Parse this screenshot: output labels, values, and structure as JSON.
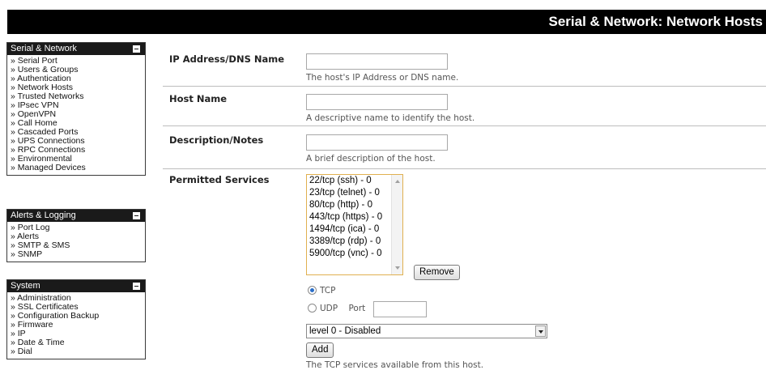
{
  "page": {
    "title": "Serial & Network: Network Hosts"
  },
  "sidebar": {
    "sections": [
      {
        "title": "Serial & Network",
        "items": [
          "» Serial Port",
          "» Users & Groups",
          "» Authentication",
          "» Network Hosts",
          "» Trusted Networks",
          "» IPsec VPN",
          "» OpenVPN",
          "» Call Home",
          "» Cascaded Ports",
          "» UPS Connections",
          "» RPC Connections",
          "» Environmental",
          "» Managed Devices"
        ]
      },
      {
        "title": "Alerts & Logging",
        "items": [
          "» Port Log",
          "» Alerts",
          "» SMTP & SMS",
          "» SNMP"
        ]
      },
      {
        "title": "System",
        "items": [
          "» Administration",
          "» SSL Certificates",
          "» Configuration Backup",
          "» Firmware",
          "» IP",
          "» Date & Time",
          "» Dial"
        ]
      }
    ]
  },
  "form": {
    "ip": {
      "label": "IP Address/DNS Name",
      "value": "",
      "hint": "The host's IP Address or DNS name."
    },
    "hostname": {
      "label": "Host Name",
      "value": "",
      "hint": "A descriptive name to identify the host."
    },
    "description": {
      "label": "Description/Notes",
      "value": "",
      "hint": "A brief description of the host."
    },
    "services": {
      "label": "Permitted Services",
      "options": [
        "22/tcp (ssh) - 0",
        "23/tcp (telnet) - 0",
        "80/tcp (http) - 0",
        "443/tcp (https) - 0",
        "1494/tcp (ica) - 0",
        "3389/tcp (rdp) - 0",
        "5900/tcp (vnc) - 0"
      ],
      "remove_label": "Remove",
      "protocol": {
        "tcp_label": "TCP",
        "udp_label": "UDP",
        "selected": "TCP"
      },
      "port_label": "Port",
      "port_value": "",
      "level_selected": "level 0 - Disabled",
      "add_label": "Add",
      "hint": "The TCP services available from this host."
    }
  }
}
